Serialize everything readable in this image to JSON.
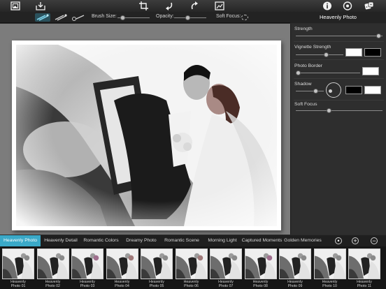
{
  "toolbar": {
    "icons": [
      "photo-library-icon",
      "share-tray-icon",
      "crop-icon",
      "undo-icon",
      "redo-icon",
      "compare-icon",
      "info-icon",
      "settings-icon",
      "random-icon"
    ]
  },
  "subbar": {
    "brush_size_label": "Brush Size:",
    "brush_size_value": 0.1,
    "opacity_label": "Opacity:",
    "opacity_value": 0.4,
    "soft_focus_label": "Soft Focus:"
  },
  "panel": {
    "title": "Heavenly Photo",
    "strength_label": "Strength",
    "strength_value": 0.98,
    "vignette_label": "Vignette Strength",
    "vignette_value": 0.65,
    "vignette_colors": [
      "#ffffff",
      "#000000"
    ],
    "border_label": "Photo Border",
    "border_value": 0.0,
    "border_color": "#ffffff",
    "shadow_label": "Shadow",
    "shadow_value": 0.75,
    "shadow_colors": [
      "#000000",
      "#ffffff"
    ],
    "soft_focus_label": "Soft Focus",
    "soft_focus_value": 0.38
  },
  "tabs": {
    "items": [
      "Heavenly Photo",
      "Heavenly Detail",
      "Romantic Colors",
      "Dreamy Photo",
      "Romantic Scene",
      "Morning Light",
      "Captured Moments",
      "Golden Memories"
    ],
    "active_index": 0
  },
  "thumbnails": [
    {
      "label1": "Heavenly",
      "label2": "Photo 01"
    },
    {
      "label1": "Heavenly",
      "label2": "Photo 02"
    },
    {
      "label1": "Heavenly",
      "label2": "Photo 03"
    },
    {
      "label1": "Heavenly",
      "label2": "Photo 04"
    },
    {
      "label1": "Heavenly",
      "label2": "Photo 05"
    },
    {
      "label1": "Heavenly",
      "label2": "Photo 06"
    },
    {
      "label1": "Heavenly",
      "label2": "Photo 07"
    },
    {
      "label1": "Heavenly",
      "label2": "Photo 08"
    },
    {
      "label1": "Heavenly",
      "label2": "Photo 09"
    },
    {
      "label1": "Heavenly",
      "label2": "Photo 10"
    },
    {
      "label1": "Heavenly",
      "label2": "Photo 11"
    }
  ],
  "colors": {
    "accent": "#3aa9c8",
    "canvas_bg": "#7c7c7c",
    "panel_bg": "#2e2e2e"
  }
}
